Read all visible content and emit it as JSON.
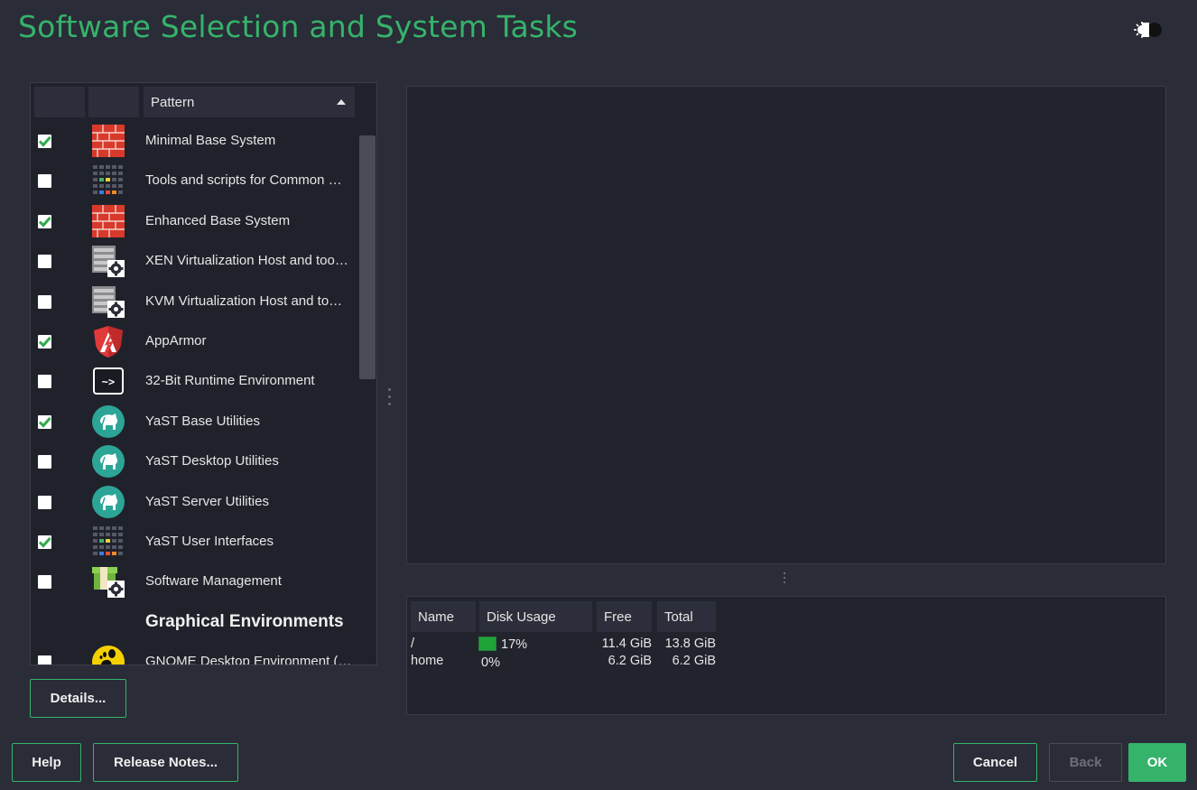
{
  "window": {
    "title": "Software Selection and System Tasks"
  },
  "theme_icon": "sun-moon-icon",
  "patterns": {
    "column_header": "Pattern",
    "sort": "ascending",
    "rows": [
      {
        "kind": "item",
        "checked": true,
        "icon": "firewall-brick-icon",
        "label": "Minimal Base System"
      },
      {
        "kind": "item",
        "checked": false,
        "icon": "grid-apps-icon",
        "label": "Tools and scripts for Common …"
      },
      {
        "kind": "item",
        "checked": true,
        "icon": "firewall-brick-icon",
        "label": "Enhanced Base System"
      },
      {
        "kind": "item",
        "checked": false,
        "icon": "server-gear-icon",
        "label": "XEN Virtualization Host and too…"
      },
      {
        "kind": "item",
        "checked": false,
        "icon": "server-gear-icon",
        "label": "KVM Virtualization Host and to…"
      },
      {
        "kind": "item",
        "checked": true,
        "icon": "apparmor-shield-icon",
        "label": "AppArmor"
      },
      {
        "kind": "item",
        "checked": false,
        "icon": "terminal-icon",
        "label": "32-Bit Runtime Environment"
      },
      {
        "kind": "item",
        "checked": true,
        "icon": "yast-logo-icon",
        "label": "YaST Base Utilities"
      },
      {
        "kind": "item",
        "checked": false,
        "icon": "yast-logo-icon",
        "label": "YaST Desktop Utilities"
      },
      {
        "kind": "item",
        "checked": false,
        "icon": "yast-logo-icon",
        "label": "YaST Server Utilities"
      },
      {
        "kind": "item",
        "checked": true,
        "icon": "grid-apps-icon",
        "label": "YaST User Interfaces"
      },
      {
        "kind": "item",
        "checked": false,
        "icon": "package-gear-icon",
        "label": "Software Management"
      },
      {
        "kind": "group",
        "label": "Graphical Environments"
      },
      {
        "kind": "item",
        "checked": false,
        "icon": "gnome-foot-icon",
        "label": "GNOME Desktop Environment (…"
      }
    ]
  },
  "disk": {
    "headers": {
      "name": "Name",
      "usage": "Disk Usage",
      "free": "Free",
      "total": "Total"
    },
    "rows": [
      {
        "name": "/",
        "usage_text": "17%",
        "usage_fraction": 0.17,
        "free": "11.4 GiB",
        "total": "13.8 GiB"
      },
      {
        "name": "home",
        "usage_text": "0%",
        "usage_fraction": 0.0,
        "free": "6.2 GiB",
        "total": "6.2 GiB"
      }
    ]
  },
  "buttons": {
    "details": "Details...",
    "help": "Help",
    "release_notes": "Release Notes...",
    "cancel": "Cancel",
    "back": "Back",
    "ok": "OK"
  },
  "colors": {
    "accent": "#35b36b",
    "background": "#2a2c37",
    "panel": "#20222b"
  }
}
